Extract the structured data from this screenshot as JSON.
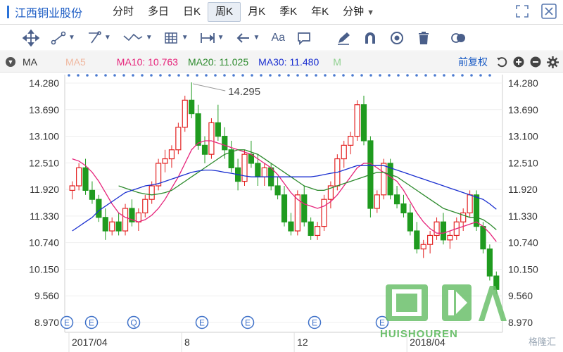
{
  "topbar": {
    "stock_name": "江西铜业股份",
    "tabs": [
      {
        "label": "分时",
        "active": false
      },
      {
        "label": "多日",
        "active": false
      },
      {
        "label": "日K",
        "active": false
      },
      {
        "label": "周K",
        "active": true
      },
      {
        "label": "月K",
        "active": false
      },
      {
        "label": "季K",
        "active": false
      },
      {
        "label": "年K",
        "active": false
      },
      {
        "label": "分钟",
        "active": false,
        "dropdown": true
      }
    ]
  },
  "toolbar": {
    "text_tool_label": "Aa"
  },
  "mabar": {
    "label": "MA",
    "ma5": "MA5",
    "ma10": "MA10: 10.763",
    "ma20": "MA20: 11.025",
    "ma30": "MA30: 11.480",
    "m": "M",
    "adjust": "前复权",
    "colors": {
      "ma5": "#f0b8a0",
      "ma10": "#e6237a",
      "ma20": "#2c8a2c",
      "ma30": "#1a2fd0",
      "m": "#8fd08f"
    }
  },
  "watermark": {
    "text": "格隆汇",
    "logo_text": "HUISHOUREN"
  },
  "chart_data": {
    "type": "candlestick",
    "y_ticks": [
      "14.280",
      "13.690",
      "13.100",
      "12.510",
      "11.920",
      "11.330",
      "10.740",
      "10.150",
      "9.560",
      "8.970"
    ],
    "x_labels": [
      "2017/04",
      "8",
      "12",
      "2018/04"
    ],
    "max_annotation": "14.295",
    "ylim": [
      8.97,
      14.28
    ],
    "event_markers": [
      "E",
      "E",
      "Q",
      "E",
      "E",
      "E",
      "E"
    ],
    "colors": {
      "up": "#e32222",
      "down": "#1f9b1f"
    },
    "candles": [
      [
        11.9,
        12.1,
        11.7,
        12.0
      ],
      [
        12.0,
        12.5,
        11.9,
        12.4
      ],
      [
        12.4,
        12.6,
        11.8,
        11.9
      ],
      [
        11.9,
        12.1,
        11.6,
        11.7
      ],
      [
        11.7,
        11.8,
        11.2,
        11.3
      ],
      [
        11.3,
        11.5,
        10.8,
        11.0
      ],
      [
        11.0,
        11.3,
        10.9,
        11.2
      ],
      [
        11.2,
        11.4,
        10.9,
        11.0
      ],
      [
        11.0,
        11.6,
        10.9,
        11.5
      ],
      [
        11.5,
        11.7,
        11.1,
        11.2
      ],
      [
        11.2,
        11.5,
        11.0,
        11.4
      ],
      [
        11.4,
        11.8,
        11.3,
        11.7
      ],
      [
        11.7,
        12.1,
        11.6,
        12.0
      ],
      [
        12.0,
        12.6,
        11.9,
        12.5
      ],
      [
        12.5,
        12.8,
        12.3,
        12.6
      ],
      [
        12.6,
        12.9,
        12.4,
        12.8
      ],
      [
        12.8,
        13.4,
        12.7,
        13.3
      ],
      [
        13.3,
        14.0,
        13.2,
        13.9
      ],
      [
        13.9,
        14.295,
        13.5,
        13.6
      ],
      [
        13.6,
        13.8,
        12.8,
        12.9
      ],
      [
        12.9,
        13.1,
        12.5,
        12.7
      ],
      [
        12.7,
        13.5,
        12.6,
        13.4
      ],
      [
        13.4,
        13.8,
        13.0,
        13.1
      ],
      [
        13.1,
        13.3,
        12.6,
        12.8
      ],
      [
        12.8,
        13.0,
        12.3,
        12.4
      ],
      [
        12.4,
        12.6,
        11.9,
        12.1
      ],
      [
        12.1,
        12.8,
        12.0,
        12.7
      ],
      [
        12.7,
        13.0,
        12.4,
        12.5
      ],
      [
        12.5,
        12.7,
        12.0,
        12.2
      ],
      [
        12.2,
        12.5,
        12.0,
        12.4
      ],
      [
        12.4,
        12.5,
        11.9,
        12.0
      ],
      [
        12.0,
        12.2,
        11.7,
        11.8
      ],
      [
        11.8,
        12.0,
        11.1,
        11.2
      ],
      [
        11.2,
        11.4,
        10.9,
        11.0
      ],
      [
        11.0,
        11.9,
        10.9,
        11.8
      ],
      [
        11.8,
        12.0,
        11.1,
        11.2
      ],
      [
        11.2,
        11.3,
        10.8,
        10.9
      ],
      [
        10.9,
        11.2,
        10.8,
        11.1
      ],
      [
        11.1,
        11.8,
        11.0,
        11.7
      ],
      [
        11.7,
        12.1,
        11.5,
        12.0
      ],
      [
        12.0,
        12.7,
        11.9,
        12.6
      ],
      [
        12.6,
        13.0,
        12.4,
        12.9
      ],
      [
        12.9,
        13.2,
        12.7,
        13.1
      ],
      [
        13.1,
        13.9,
        13.0,
        13.8
      ],
      [
        13.8,
        14.0,
        12.9,
        13.0
      ],
      [
        13.0,
        13.1,
        11.3,
        11.5
      ],
      [
        11.5,
        11.9,
        11.4,
        11.8
      ],
      [
        11.8,
        12.6,
        11.7,
        12.5
      ],
      [
        12.5,
        12.6,
        11.7,
        11.8
      ],
      [
        11.8,
        12.0,
        11.5,
        11.6
      ],
      [
        11.6,
        11.8,
        11.3,
        11.4
      ],
      [
        11.4,
        11.6,
        10.9,
        11.0
      ],
      [
        11.0,
        11.2,
        10.5,
        10.6
      ],
      [
        10.6,
        10.8,
        10.4,
        10.7
      ],
      [
        10.7,
        11.0,
        10.5,
        10.9
      ],
      [
        10.9,
        11.3,
        10.8,
        11.2
      ],
      [
        11.2,
        11.4,
        10.7,
        10.8
      ],
      [
        10.8,
        11.0,
        10.6,
        10.9
      ],
      [
        10.9,
        11.3,
        10.8,
        11.2
      ],
      [
        11.2,
        11.5,
        11.0,
        11.4
      ],
      [
        11.4,
        11.9,
        11.3,
        11.8
      ],
      [
        11.8,
        11.9,
        11.0,
        11.1
      ],
      [
        11.1,
        11.2,
        10.5,
        10.6
      ],
      [
        10.6,
        10.7,
        9.9,
        10.0
      ],
      [
        10.0,
        10.1,
        9.6,
        9.7
      ]
    ],
    "series": [
      {
        "name": "MA10",
        "color": "#e6237a",
        "values": [
          12.6,
          12.55,
          12.45,
          12.3,
          12.1,
          11.85,
          11.6,
          11.4,
          11.3,
          11.25,
          11.2,
          11.25,
          11.35,
          11.5,
          11.7,
          11.95,
          12.2,
          12.5,
          12.8,
          12.95,
          13.0,
          13.0,
          12.95,
          12.9,
          12.85,
          12.8,
          12.75,
          12.7,
          12.6,
          12.5,
          12.4,
          12.25,
          12.05,
          11.85,
          11.7,
          11.6,
          11.55,
          11.5,
          11.55,
          11.65,
          11.8,
          12.0,
          12.2,
          12.4,
          12.5,
          12.5,
          12.4,
          12.3,
          12.2,
          12.1,
          11.9,
          11.65,
          11.4,
          11.2,
          11.05,
          10.95,
          10.95,
          11.0,
          11.05,
          11.1,
          11.15,
          11.2,
          11.1,
          10.95,
          10.763
        ]
      },
      {
        "name": "MA20",
        "color": "#2c8a2c",
        "values": [
          null,
          null,
          null,
          null,
          null,
          null,
          null,
          12.0,
          11.95,
          11.9,
          11.85,
          11.82,
          11.8,
          11.82,
          11.85,
          11.9,
          12.0,
          12.1,
          12.2,
          12.3,
          12.4,
          12.5,
          12.6,
          12.7,
          12.75,
          12.8,
          12.8,
          12.75,
          12.7,
          12.6,
          12.5,
          12.4,
          12.3,
          12.2,
          12.1,
          12.0,
          11.95,
          11.9,
          11.9,
          11.95,
          12.0,
          12.05,
          12.1,
          12.15,
          12.2,
          12.25,
          12.3,
          12.3,
          12.25,
          12.2,
          12.1,
          12.0,
          11.9,
          11.8,
          11.7,
          11.6,
          11.5,
          11.45,
          11.4,
          11.35,
          11.3,
          11.3,
          11.25,
          11.15,
          11.025
        ]
      },
      {
        "name": "MA30",
        "color": "#1a2fd0",
        "values": [
          11.0,
          11.1,
          11.2,
          11.3,
          11.45,
          11.55,
          11.65,
          11.75,
          11.85,
          11.9,
          11.95,
          12.0,
          12.02,
          12.05,
          12.1,
          12.15,
          12.2,
          12.25,
          12.3,
          12.33,
          12.35,
          12.35,
          12.33,
          12.3,
          12.28,
          12.25,
          12.22,
          12.2,
          12.2,
          12.2,
          12.2,
          12.2,
          12.2,
          12.2,
          12.2,
          12.2,
          12.2,
          12.22,
          12.25,
          12.28,
          12.3,
          12.35,
          12.4,
          12.45,
          12.45,
          12.45,
          12.45,
          12.45,
          12.4,
          12.35,
          12.3,
          12.25,
          12.2,
          12.15,
          12.1,
          12.05,
          12.0,
          11.95,
          11.9,
          11.85,
          11.8,
          11.75,
          11.7,
          11.6,
          11.48
        ]
      }
    ]
  }
}
